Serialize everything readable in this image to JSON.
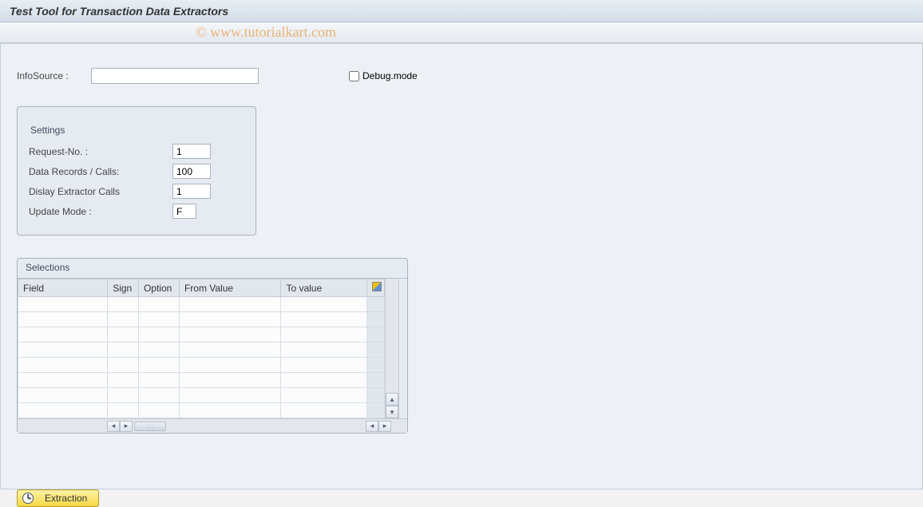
{
  "header": {
    "title": "Test Tool for Transaction Data Extractors"
  },
  "watermark": "© www.tutorialkart.com",
  "top": {
    "infosource_label": "InfoSource :",
    "infosource_value": "",
    "debug_label": "Debug.mode",
    "debug_checked": false
  },
  "settings": {
    "group_title": "Settings",
    "rows": [
      {
        "label": "Request-No. :",
        "value": "1"
      },
      {
        "label": "Data Records / Calls:",
        "value": "100"
      },
      {
        "label": "Dislay Extractor Calls",
        "value": "1"
      },
      {
        "label": "Update Mode :",
        "value": "F"
      }
    ]
  },
  "selections": {
    "group_title": "Selections",
    "columns": {
      "field": "Field",
      "sign": "Sign",
      "option": "Option",
      "from": "From Value",
      "to": "To value"
    },
    "row_count": 8
  },
  "actions": {
    "extraction_label": "Extraction"
  }
}
